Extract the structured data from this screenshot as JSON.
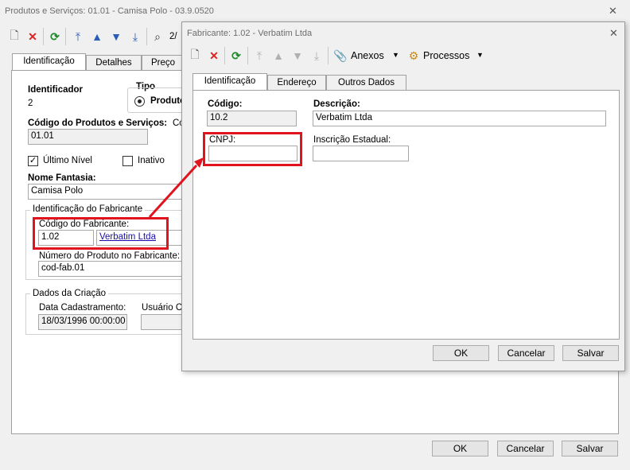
{
  "main_window": {
    "title": "Produtos e Serviços: 01.01 - Camisa Polo - 03.9.0520",
    "toolbar_nav": "2/",
    "tabs": [
      "Identificação",
      "Detalhes",
      "Preço"
    ],
    "identificador_label": "Identificador",
    "identificador_value": "2",
    "tipo_label": "Tipo",
    "tipo_option": "Produto",
    "codigo_label": "Código do Produtos e Serviços:",
    "codigo_label_trunc": "Có",
    "codigo_value": "01.01",
    "ultimo_nivel_label": "Último Nível",
    "inativo_label": "Inativo",
    "nome_fantasia_label": "Nome Fantasia:",
    "nome_fantasia_value": "Camisa Polo",
    "fabricante_group": "Identificação do Fabricante",
    "cod_fabricante_label": "Código do Fabricante:",
    "cod_fabricante_value": "1.02",
    "fabricante_link": "Verbatim Ltda",
    "numero_produto_label": "Número do Produto no Fabricante:",
    "numero_produto_value": "cod-fab.01",
    "criacao_group": "Dados da Criação",
    "data_cadastro_label": "Data Cadastramento:",
    "data_cadastro_value": "18/03/1996 00:00:00",
    "usuario_label": "Usuário Cri",
    "ok": "OK",
    "cancel": "Cancelar",
    "save": "Salvar"
  },
  "dialog": {
    "title": "Fabricante: 1.02 - Verbatim Ltda",
    "anexos": "Anexos",
    "processos": "Processos",
    "tabs": [
      "Identificação",
      "Endereço",
      "Outros Dados"
    ],
    "codigo_label": "Código:",
    "codigo_value": "10.2",
    "descricao_label": "Descrição:",
    "descricao_value": "Verbatim Ltda",
    "cnpj_label": "CNPJ:",
    "cnpj_value": "",
    "ie_label": "Inscrição Estadual:",
    "ie_value": "",
    "ok": "OK",
    "cancel": "Cancelar",
    "save": "Salvar"
  },
  "colors": {
    "highlight": "#e0131f",
    "link": "#1a0dab"
  }
}
